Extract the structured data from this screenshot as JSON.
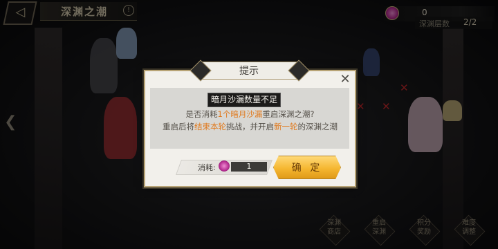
{
  "header": {
    "back_icon": "back-arrow-icon",
    "title": "深渊之潮",
    "info_icon": "info-icon"
  },
  "currency": {
    "icon": "gem-icon",
    "value": "0",
    "floor_label": "深渊层数",
    "floor_value": "2/2"
  },
  "dialog": {
    "title": "提示",
    "close_icon": "close-icon",
    "toast": "暗月沙漏数量不足",
    "line1_prefix": "是否消耗",
    "line1_highlight": "1个暗月沙漏",
    "line1_suffix": "重启深渊之潮?",
    "line2_prefix": "重启后将",
    "line2_highlight1": "结束本轮",
    "line2_middle": "挑战，并开启",
    "line2_highlight2": "新一轮",
    "line2_suffix": "的深渊之潮",
    "cost_label": "消耗:",
    "cost_value": "1",
    "confirm_label": "确 定",
    "highlight_color": "#e0791c"
  },
  "bottom_menu": [
    {
      "label": "深渊\n商店"
    },
    {
      "label": "重启\n深渊"
    },
    {
      "label": "积分\n奖励"
    },
    {
      "label": "难度\n调整"
    }
  ]
}
